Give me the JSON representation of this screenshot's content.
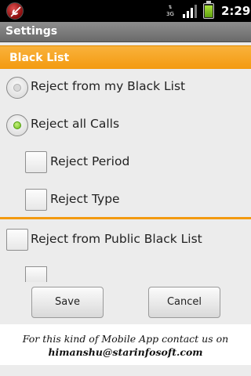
{
  "status_bar": {
    "app_icon": "no-phone-icon",
    "network": "3G",
    "signal_icon": "signal-bars-icon",
    "battery_icon": "battery-icon",
    "battery_level": 0.85,
    "time": "2:29"
  },
  "window": {
    "title": "Settings"
  },
  "black_list": {
    "header": "Black List",
    "options": [
      {
        "label": "Reject from my Black List",
        "type": "radio",
        "checked": false
      },
      {
        "label": "Reject all Calls",
        "type": "radio",
        "checked": true
      },
      {
        "label": "Reject Period",
        "type": "checkbox",
        "checked": false
      },
      {
        "label": "Reject Type",
        "type": "checkbox",
        "checked": false
      }
    ],
    "public_option": {
      "label": "Reject from Public Black List",
      "type": "checkbox",
      "checked": false
    }
  },
  "buttons": {
    "save": "Save",
    "cancel": "Cancel"
  },
  "footer": {
    "line1": "For this kind of Mobile App contact us on",
    "line2": "himanshu@starinfosoft.com"
  },
  "colors": {
    "accent": "#f39a10",
    "radio_checked": "#6fbf1a",
    "title_bar": "#7a7a7a",
    "background": "#ececec"
  }
}
